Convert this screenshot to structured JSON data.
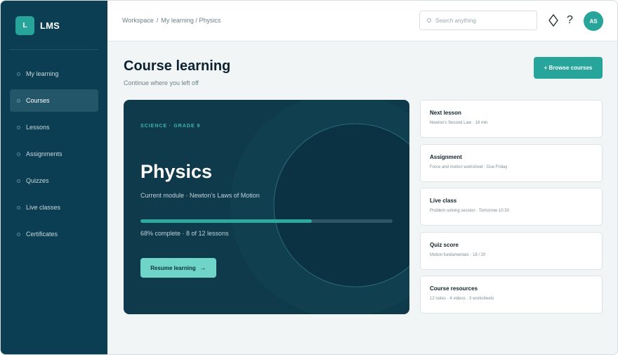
{
  "app": {
    "logo_letter": "L",
    "name": "LMS"
  },
  "sidebar": {
    "items": [
      {
        "label": "My learning"
      },
      {
        "label": "Courses"
      },
      {
        "label": "Lessons"
      },
      {
        "label": "Assignments"
      },
      {
        "label": "Quizzes"
      },
      {
        "label": "Live classes"
      },
      {
        "label": "Certificates"
      }
    ],
    "active": "Courses"
  },
  "topbar": {
    "breadcrumb": [
      "Workspace",
      "My learning / Physics"
    ],
    "search_placeholder": "Search anything",
    "help_symbol": "?",
    "avatar_initials": "AS"
  },
  "main": {
    "title": "Course learning",
    "subtitle": "Continue where you left off",
    "browse_button": "+ Browse courses"
  },
  "course": {
    "eyebrow": "SCIENCE · GRADE 9",
    "title": "Physics",
    "module": "Current module · Newton's Laws of Motion",
    "progress_percent": 68,
    "progress_text": "68% complete · 8 of 12 lessons",
    "resume_button": "Resume learning",
    "resume_arrow": "→"
  },
  "cards": [
    {
      "title": "Next lesson",
      "subtitle": "Newton's Second Law · 18 min"
    },
    {
      "title": "Assignment",
      "subtitle": "Force and motion worksheet · Due Friday"
    },
    {
      "title": "Live class",
      "subtitle": "Problem solving session · Tomorrow 10:30"
    },
    {
      "title": "Quiz score",
      "subtitle": "Motion fundamentals · 18 / 20"
    },
    {
      "title": "Course resources",
      "subtitle": "12 notes · 4 videos · 3 worksheets"
    }
  ],
  "colors": {
    "sidebar": "#0b3e52",
    "accent": "#27a59b",
    "hero": "#0e3a4b",
    "resume_button": "#6ed5c8"
  }
}
